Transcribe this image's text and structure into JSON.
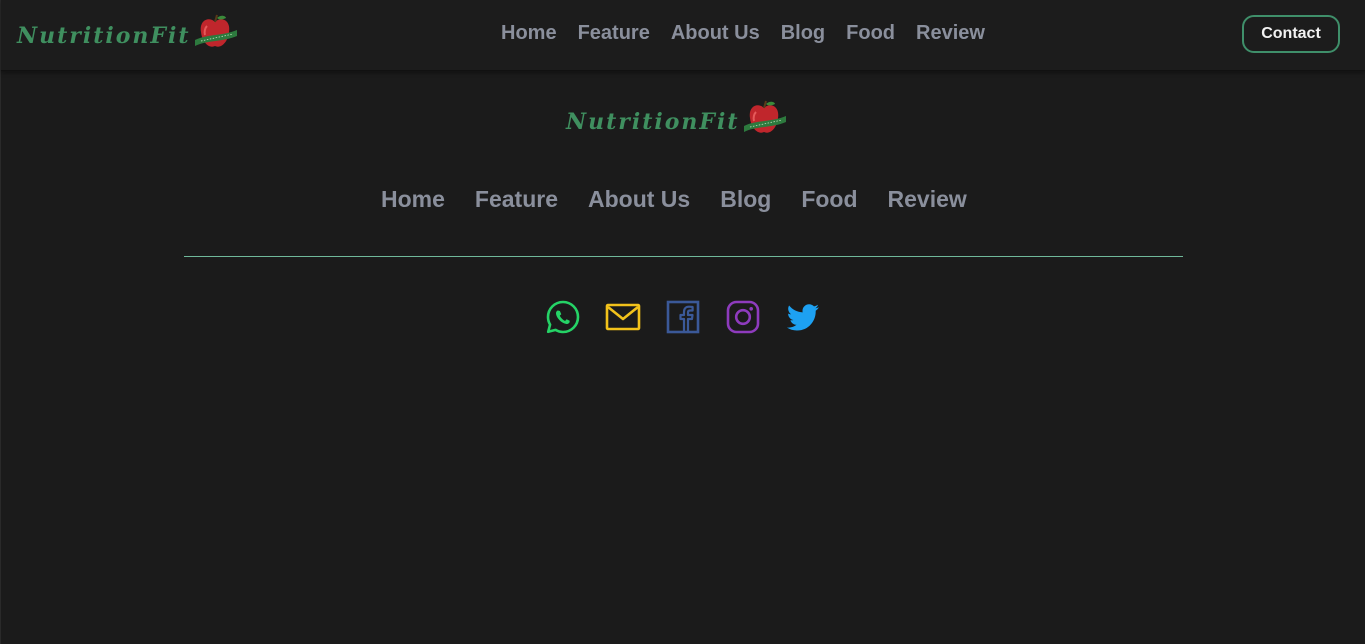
{
  "brand": {
    "name": "NutritionFit",
    "color": "#3f8f5f",
    "logo_icon": "apple-icon"
  },
  "header": {
    "nav": [
      "Home",
      "Feature",
      "About Us",
      "Blog",
      "Food",
      "Review"
    ],
    "contact_label": "Contact"
  },
  "footer": {
    "nav": [
      "Home",
      "Feature",
      "About Us",
      "Blog",
      "Food",
      "Review"
    ],
    "socials": [
      {
        "icon": "whatsapp-icon",
        "color": "#25d366"
      },
      {
        "icon": "email-icon",
        "color": "#f2c21b"
      },
      {
        "icon": "facebook-icon",
        "color": "#3b5998"
      },
      {
        "icon": "instagram-icon",
        "color": "#8e3bbd"
      },
      {
        "icon": "twitter-icon",
        "color": "#1da1f2"
      }
    ]
  },
  "colors": {
    "background": "#1b1b1b",
    "nav_text": "#8a8f9c",
    "accent": "#3f8f6a"
  }
}
